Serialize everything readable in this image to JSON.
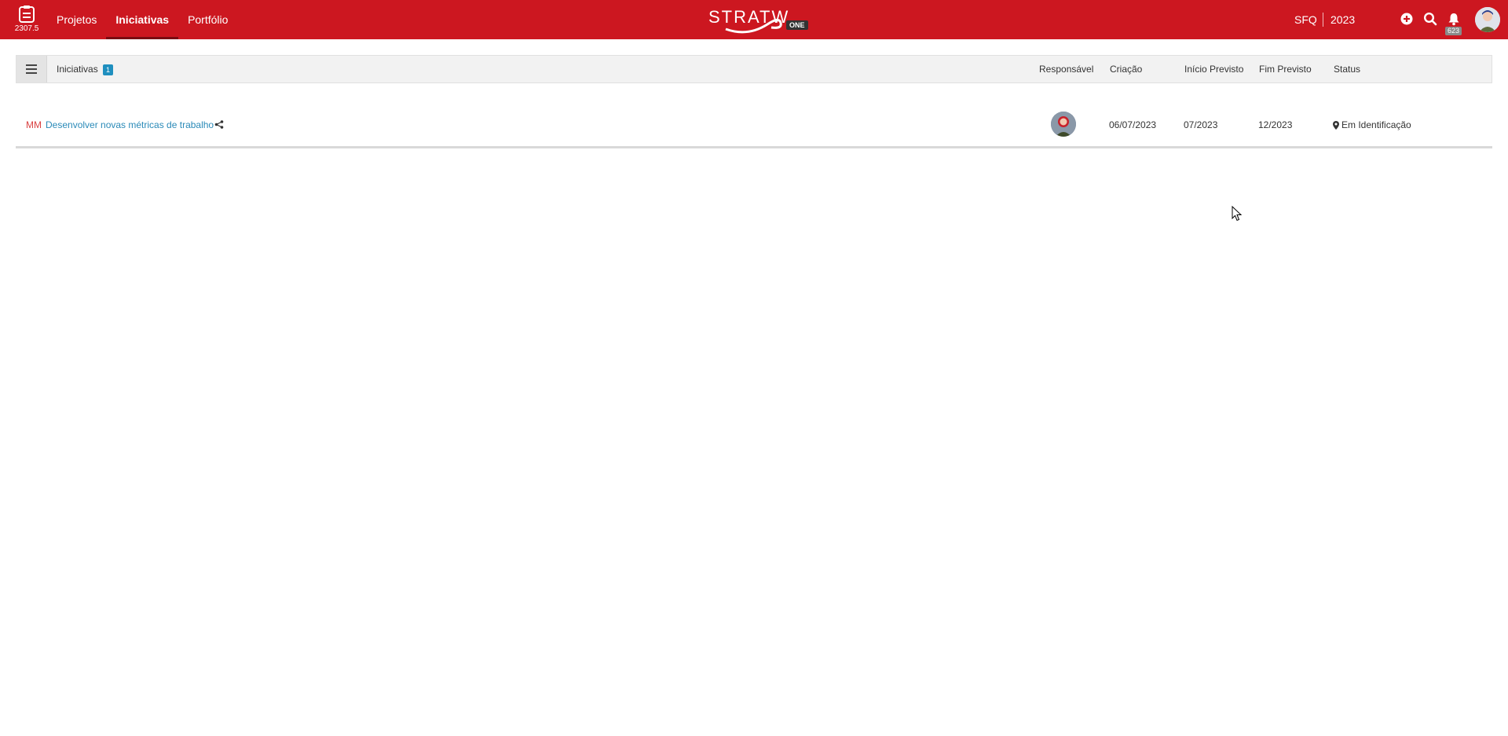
{
  "app": {
    "version": "2307.5",
    "brand_name": "STRATW",
    "brand_badge": "ONE"
  },
  "nav": {
    "items": [
      {
        "label": "Projetos",
        "active": false
      },
      {
        "label": "Iniciativas",
        "active": true
      },
      {
        "label": "Portfólio",
        "active": false
      }
    ]
  },
  "header_right": {
    "org": "SFQ",
    "year": "2023",
    "notification_count": "623",
    "icons": [
      "plus-circle-icon",
      "search-icon",
      "bell-icon"
    ]
  },
  "panel": {
    "title": "Iniciativas",
    "count": "1",
    "columns": {
      "responsavel": "Responsável",
      "criacao": "Criação",
      "inicio": "Início Previsto",
      "fim": "Fim Previsto",
      "status": "Status"
    }
  },
  "rows": [
    {
      "code": "MM",
      "title": "Desenvolver novas métricas de trabalho",
      "criacao": "06/07/2023",
      "inicio": "07/2023",
      "fim": "12/2023",
      "status": "Em Identificação"
    }
  ],
  "colors": {
    "topbar": "#cc1720",
    "link": "#2a8ab8",
    "code": "#d94040",
    "badge": "#1f8fbf"
  }
}
